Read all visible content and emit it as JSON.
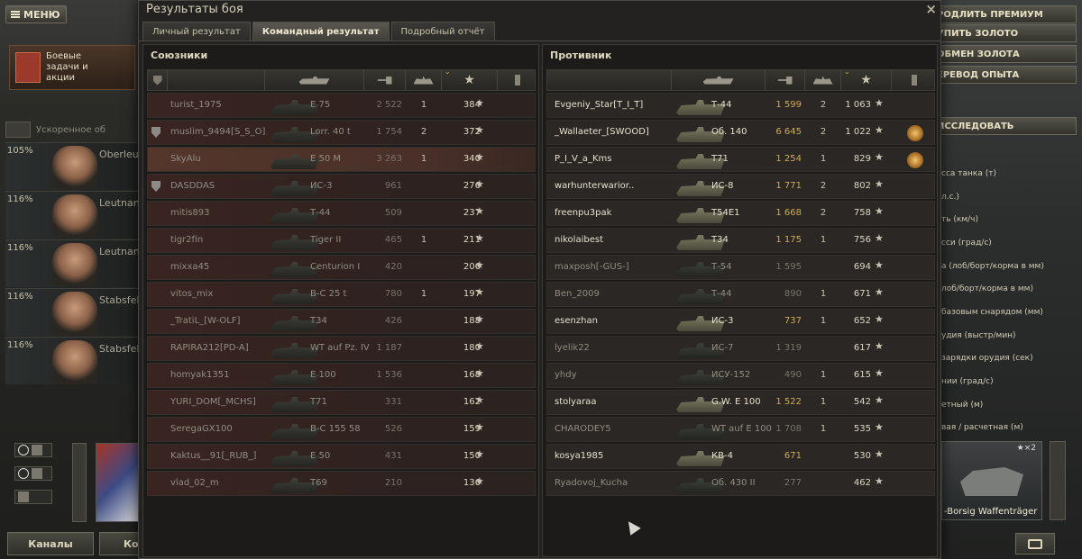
{
  "app": {
    "menu_label": "МЕНЮ",
    "missions_label": "Боевые задачи и акции",
    "crew_header": "Ускоренное об",
    "crew": [
      {
        "pct": "105%",
        "rank": "Oberleut"
      },
      {
        "pct": "116%",
        "rank": "Leutnant"
      },
      {
        "pct": "116%",
        "rank": "Leutnant"
      },
      {
        "pct": "116%",
        "rank": "Stabsfeld"
      },
      {
        "pct": "116%",
        "rank": "Stabsfeld"
      }
    ],
    "channels_label": "Каналы",
    "bottom_label2": "Кон",
    "right_buttons": [
      "РОДЛИТЬ ПРЕМИУМ",
      "УПИТЬ ЗОЛОТО",
      "ОБМЕН ЗОЛОТА",
      "ЕРЕВОД ОПЫТА"
    ],
    "research_label": "ИССЛЕДОВАТЬ",
    "params": [
      "сса танка (т)",
      "л.с.)",
      "ть (км/ч)",
      "сси (град/с)",
      "а (лоб/борт/корма в мм)",
      "лоб/борт/корма в мм)",
      "базовым снарядом (мм)",
      "удия (выстр/мин)",
      "зарядки орудия (сек)",
      "нии (град/с)",
      "етный (м)",
      "вая / расчетная (м)"
    ],
    "tank_card_name": "-Borsig Waffenträger",
    "tank_card_badge": "★×2"
  },
  "dialog": {
    "title": "Результаты боя",
    "close": "×",
    "tabs": [
      "Личный результат",
      "Командный результат",
      "Подробный отчёт"
    ],
    "active_tab": 1,
    "allies_title": "Союзники",
    "enemies_title": "Противник",
    "sort_mark": "⌄"
  },
  "allies": [
    {
      "name": "turist_1975",
      "tank": "E 75",
      "dmg": "2 522",
      "frags": "1",
      "xp": "384",
      "clan": false,
      "alive": false,
      "mine": false,
      "medal": false
    },
    {
      "name": "muslim_9494[S_S_O]",
      "tank": "Lorr. 40 t",
      "dmg": "1 754",
      "frags": "2",
      "xp": "372",
      "clan": true,
      "alive": false,
      "mine": false,
      "medal": false
    },
    {
      "name": "SkyAlu",
      "tank": "E 50 M",
      "dmg": "3 263",
      "frags": "1",
      "xp": "340",
      "clan": false,
      "alive": false,
      "mine": true,
      "medal": false
    },
    {
      "name": "DASDDAS",
      "tank": "ИС-3",
      "dmg": "961",
      "frags": "",
      "xp": "276",
      "clan": true,
      "alive": false,
      "mine": false,
      "medal": false
    },
    {
      "name": "mitis893",
      "tank": "Т-44",
      "dmg": "509",
      "frags": "",
      "xp": "237",
      "clan": false,
      "alive": false,
      "mine": false,
      "medal": false
    },
    {
      "name": "tigr2fin",
      "tank": "Tiger II",
      "dmg": "465",
      "frags": "1",
      "xp": "211",
      "clan": false,
      "alive": false,
      "mine": false,
      "medal": false
    },
    {
      "name": "mixxa45",
      "tank": "Centurion I",
      "dmg": "420",
      "frags": "",
      "xp": "206",
      "clan": false,
      "alive": false,
      "mine": false,
      "medal": false
    },
    {
      "name": "vitos_mix",
      "tank": "B-C 25 t",
      "dmg": "780",
      "frags": "1",
      "xp": "197",
      "clan": false,
      "alive": false,
      "mine": false,
      "medal": false
    },
    {
      "name": "_TratiL_[W-OLF]",
      "tank": "T34",
      "dmg": "426",
      "frags": "",
      "xp": "188",
      "clan": false,
      "alive": false,
      "mine": false,
      "medal": false
    },
    {
      "name": "RAPIRA212[PD-A]",
      "tank": "WT auf Pz. IV",
      "dmg": "1 187",
      "frags": "",
      "xp": "180",
      "clan": false,
      "alive": false,
      "mine": false,
      "medal": false
    },
    {
      "name": "homyak1351",
      "tank": "E 100",
      "dmg": "1 536",
      "frags": "",
      "xp": "168",
      "clan": false,
      "alive": false,
      "mine": false,
      "medal": false
    },
    {
      "name": "YURI_DOM[_MCHS]",
      "tank": "T71",
      "dmg": "331",
      "frags": "",
      "xp": "162",
      "clan": false,
      "alive": false,
      "mine": false,
      "medal": false
    },
    {
      "name": "SeregaGX100",
      "tank": "B-C 155 58",
      "dmg": "526",
      "frags": "",
      "xp": "159",
      "clan": false,
      "alive": false,
      "mine": false,
      "medal": false
    },
    {
      "name": "Kaktus__91[_RUB_]",
      "tank": "E 50",
      "dmg": "431",
      "frags": "",
      "xp": "150",
      "clan": false,
      "alive": false,
      "mine": false,
      "medal": false
    },
    {
      "name": "vlad_02_m",
      "tank": "T69",
      "dmg": "210",
      "frags": "",
      "xp": "136",
      "clan": false,
      "alive": false,
      "mine": false,
      "medal": false
    }
  ],
  "enemies": [
    {
      "name": "Evgeniy_Star[T_I_T]",
      "tank": "Т-44",
      "dmg": "1 599",
      "frags": "2",
      "xp": "1 063",
      "alive": true,
      "medal": false
    },
    {
      "name": "_Wallaeter_[SWOOD]",
      "tank": "Об. 140",
      "dmg": "6 645",
      "frags": "2",
      "xp": "1 022",
      "alive": true,
      "medal": true
    },
    {
      "name": "P_I_V_a_Kms",
      "tank": "T71",
      "dmg": "1 254",
      "frags": "1",
      "xp": "829",
      "alive": true,
      "medal": true
    },
    {
      "name": "warhunterwarior..",
      "tank": "ИС-8",
      "dmg": "1 771",
      "frags": "2",
      "xp": "802",
      "alive": true,
      "medal": false
    },
    {
      "name": "freenpu3pak",
      "tank": "T54E1",
      "dmg": "1 668",
      "frags": "2",
      "xp": "758",
      "alive": true,
      "medal": false
    },
    {
      "name": "nikolaibest",
      "tank": "T34",
      "dmg": "1 175",
      "frags": "1",
      "xp": "756",
      "alive": true,
      "medal": false
    },
    {
      "name": "maxposh[-GUS-]",
      "tank": "Т-54",
      "dmg": "1 595",
      "frags": "",
      "xp": "694",
      "alive": false,
      "medal": false
    },
    {
      "name": "Ben_2009",
      "tank": "Т-44",
      "dmg": "890",
      "frags": "1",
      "xp": "671",
      "alive": false,
      "medal": false
    },
    {
      "name": "esenzhan",
      "tank": "ИС-3",
      "dmg": "737",
      "frags": "1",
      "xp": "652",
      "alive": true,
      "medal": false
    },
    {
      "name": "lyelik22",
      "tank": "ИС-7",
      "dmg": "1 319",
      "frags": "",
      "xp": "617",
      "alive": false,
      "medal": false
    },
    {
      "name": "yhdy",
      "tank": "ИСУ-152",
      "dmg": "490",
      "frags": "1",
      "xp": "615",
      "alive": false,
      "medal": false
    },
    {
      "name": "stolyaraa",
      "tank": "G.W. E 100",
      "dmg": "1 522",
      "frags": "1",
      "xp": "542",
      "alive": true,
      "medal": false
    },
    {
      "name": "CHARODEY5",
      "tank": "WT auf E 100",
      "dmg": "1 708",
      "frags": "1",
      "xp": "535",
      "alive": false,
      "medal": false
    },
    {
      "name": "kosya1985",
      "tank": "КВ-4",
      "dmg": "671",
      "frags": "",
      "xp": "530",
      "alive": true,
      "medal": false
    },
    {
      "name": "Ryadovoj_Kucha",
      "tank": "Об. 430 II",
      "dmg": "277",
      "frags": "",
      "xp": "462",
      "alive": false,
      "medal": false
    }
  ]
}
